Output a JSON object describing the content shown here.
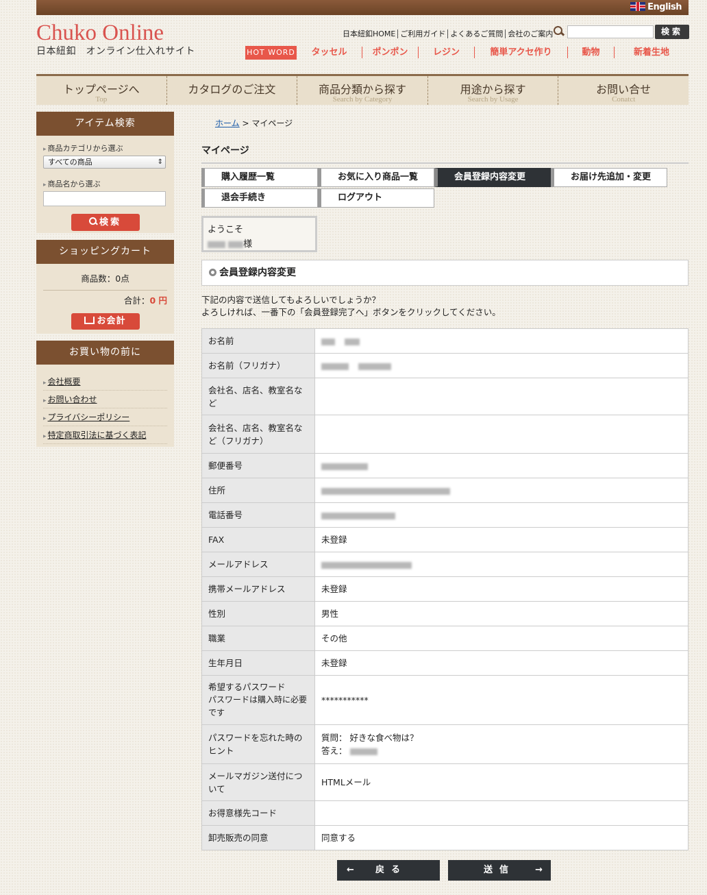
{
  "header": {
    "english_label": "English",
    "logo_title": "Chuko Online",
    "logo_sub": "日本紐釦　オンライン仕入れサイト",
    "util_links": [
      "日本紐釦HOME",
      "ご利用ガイド",
      "よくあるご質問",
      "会社のご案内"
    ],
    "search_button": "検索",
    "hotword_label": "HOT WORD",
    "hot_links": [
      "タッセル",
      "ポンポン",
      "レジン",
      "簡単アクセ作り",
      "動物",
      "新着生地"
    ]
  },
  "main_nav": [
    {
      "jp": "トップページへ",
      "en": "Top"
    },
    {
      "jp": "カタログのご注文",
      "en": ""
    },
    {
      "jp": "商品分類から探す",
      "en": "Search by Category"
    },
    {
      "jp": "用途から探す",
      "en": "Search by Usage"
    },
    {
      "jp": "お問い合せ",
      "en": "Conatct"
    }
  ],
  "sidebar": {
    "item_search": {
      "title": "アイテム検索",
      "category_label": "商品カテゴリから選ぶ",
      "category_selected": "すべての商品",
      "name_label": "商品名から選ぶ",
      "search_button": "検索"
    },
    "cart": {
      "title": "ショッピングカート",
      "count_text": "商品数：0点",
      "total_label": "合計：",
      "total_value": "0 円",
      "checkout_button": "お会計"
    },
    "before_shopping": {
      "title": "お買い物の前に",
      "links": [
        "会社概要",
        "お問い合わせ",
        "プライバシーポリシー",
        "特定商取引法に基づく表記"
      ]
    }
  },
  "breadcrumb": {
    "home": "ホーム",
    "current": " > マイページ"
  },
  "page_title": "マイページ",
  "tabs": [
    "購入履歴一覧",
    "お気に入り商品一覧",
    "会員登録内容変更",
    "お届け先追加・変更",
    "退会手続き",
    "ログアウト"
  ],
  "welcome": {
    "greeting": "ようこそ",
    "suffix": "様"
  },
  "section_title": "会員登録内容変更",
  "message_lines": [
    "下記の内容で送信してもよろしいでしょうか？",
    "よろしければ、一番下の「会員登録完了へ」ボタンをクリックしてください。"
  ],
  "form_rows": [
    {
      "label": "お名前",
      "value": ""
    },
    {
      "label": "お名前（フリガナ）",
      "value": ""
    },
    {
      "label": "会社名、店名、教室名など",
      "value": ""
    },
    {
      "label": "会社名、店名、教室名など（フリガナ）",
      "value": ""
    },
    {
      "label": "郵便番号",
      "value": ""
    },
    {
      "label": "住所",
      "value": ""
    },
    {
      "label": "電話番号",
      "value": ""
    },
    {
      "label": "FAX",
      "value": "未登録"
    },
    {
      "label": "メールアドレス",
      "value": ""
    },
    {
      "label": "携帯メールアドレス",
      "value": "未登録"
    },
    {
      "label": "性別",
      "value": "男性"
    },
    {
      "label": "職業",
      "value": "その他"
    },
    {
      "label": "生年月日",
      "value": "未登録"
    },
    {
      "label": "希望するパスワード",
      "label2": "パスワードは購入時に必要です",
      "value": "***********"
    },
    {
      "label": "パスワードを忘れた時のヒント",
      "value": "質問：  好きな食べ物は？",
      "value2": "答え："
    },
    {
      "label": "メールマガジン送付について",
      "value": "HTMLメール"
    },
    {
      "label": "お得意様先コード",
      "value": ""
    },
    {
      "label": "卸売販売の同意",
      "value": "同意する"
    }
  ],
  "buttons": {
    "back": "戻る",
    "send": "送信"
  }
}
